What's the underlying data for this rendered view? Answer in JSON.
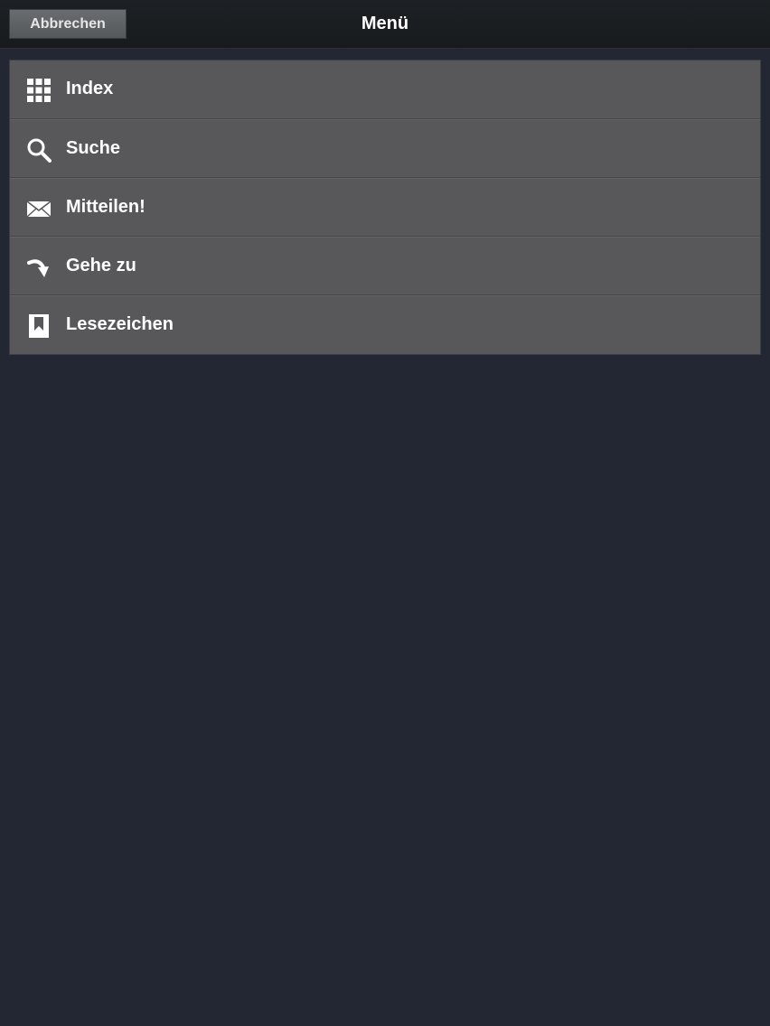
{
  "header": {
    "title": "Menü",
    "cancel_label": "Abbrechen"
  },
  "menu": {
    "items": [
      {
        "label": "Index",
        "icon": "grid-icon"
      },
      {
        "label": "Suche",
        "icon": "search-icon"
      },
      {
        "label": "Mitteilen!",
        "icon": "envelope-icon"
      },
      {
        "label": "Gehe zu",
        "icon": "curved-arrow-icon"
      },
      {
        "label": "Lesezeichen",
        "icon": "bookmark-icon"
      }
    ]
  },
  "colors": {
    "background": "#222733",
    "topbar": "#1b1e21",
    "menu_item": "#58585b",
    "text": "#ffffff"
  }
}
